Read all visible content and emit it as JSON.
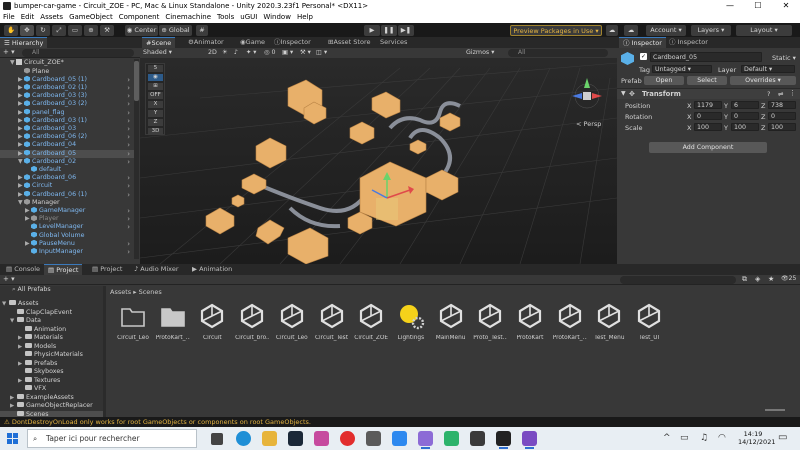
{
  "window": {
    "title": "bumper-car-game - Circuit_ZOE - PC, Mac & Linux Standalone - Unity 2020.3.23f1 Personal* <DX11>",
    "controls": [
      "—",
      "☐",
      "✕"
    ]
  },
  "menu": [
    "File",
    "Edit",
    "Assets",
    "GameObject",
    "Component",
    "Cinemachine",
    "Tools",
    "uGUI",
    "Window",
    "Help"
  ],
  "toolbar": {
    "pivot": "Center",
    "space": "Global",
    "packages": "Preview Packages in Use ▾",
    "account": "Account",
    "layers": "Layers",
    "layout": "Layout"
  },
  "hierarchy": {
    "tab": "Hierarchy",
    "search_placeholder": "All",
    "root": "Circuit_ZOE*",
    "items": [
      {
        "label": "Plane",
        "indent": 2,
        "prefab": false,
        "arrow": false,
        "selected": false,
        "dim": false,
        "expand": ""
      },
      {
        "label": "Cardboard_05 (1)",
        "indent": 2,
        "prefab": true,
        "arrow": true,
        "selected": false,
        "dim": false,
        "expand": "▶"
      },
      {
        "label": "Cardboard_02 (1)",
        "indent": 2,
        "prefab": true,
        "arrow": true,
        "selected": false,
        "dim": false,
        "expand": "▶"
      },
      {
        "label": "Cardboard_03 (3)",
        "indent": 2,
        "prefab": true,
        "arrow": true,
        "selected": false,
        "dim": false,
        "expand": "▶"
      },
      {
        "label": "Cardboard_03 (2)",
        "indent": 2,
        "prefab": true,
        "arrow": true,
        "selected": false,
        "dim": false,
        "expand": "▶"
      },
      {
        "label": "panel_flag",
        "indent": 2,
        "prefab": true,
        "arrow": true,
        "selected": false,
        "dim": false,
        "expand": "▶"
      },
      {
        "label": "Cardboard_03 (1)",
        "indent": 2,
        "prefab": true,
        "arrow": true,
        "selected": false,
        "dim": false,
        "expand": "▶"
      },
      {
        "label": "Cardboard_03",
        "indent": 2,
        "prefab": true,
        "arrow": true,
        "selected": false,
        "dim": false,
        "expand": "▶"
      },
      {
        "label": "Cardboard_06 (2)",
        "indent": 2,
        "prefab": true,
        "arrow": true,
        "selected": false,
        "dim": false,
        "expand": "▶"
      },
      {
        "label": "Cardboard_04",
        "indent": 2,
        "prefab": true,
        "arrow": true,
        "selected": false,
        "dim": false,
        "expand": "▶"
      },
      {
        "label": "Cardboard_05",
        "indent": 2,
        "prefab": true,
        "arrow": true,
        "selected": true,
        "dim": false,
        "expand": "▶"
      },
      {
        "label": "Cardboard_02",
        "indent": 2,
        "prefab": true,
        "arrow": true,
        "selected": false,
        "dim": false,
        "expand": "▼"
      },
      {
        "label": "default",
        "indent": 3,
        "prefab": true,
        "arrow": false,
        "selected": false,
        "dim": false,
        "expand": ""
      },
      {
        "label": "Cardboard_06",
        "indent": 2,
        "prefab": true,
        "arrow": true,
        "selected": false,
        "dim": false,
        "expand": "▶"
      },
      {
        "label": "Circuit",
        "indent": 2,
        "prefab": true,
        "arrow": true,
        "selected": false,
        "dim": false,
        "expand": "▶"
      },
      {
        "label": "Cardboard_06 (1)",
        "indent": 2,
        "prefab": true,
        "arrow": true,
        "selected": false,
        "dim": false,
        "expand": "▶"
      },
      {
        "label": "Manager",
        "indent": 2,
        "prefab": false,
        "arrow": false,
        "selected": false,
        "dim": false,
        "expand": "▼"
      },
      {
        "label": "GameManager",
        "indent": 3,
        "prefab": true,
        "arrow": true,
        "selected": false,
        "dim": false,
        "expand": "▶"
      },
      {
        "label": "Player",
        "indent": 3,
        "prefab": false,
        "arrow": true,
        "selected": false,
        "dim": true,
        "expand": "▶"
      },
      {
        "label": "LevelManager",
        "indent": 3,
        "prefab": true,
        "arrow": true,
        "selected": false,
        "dim": false,
        "expand": ""
      },
      {
        "label": "Global Volume",
        "indent": 3,
        "prefab": true,
        "arrow": false,
        "selected": false,
        "dim": false,
        "expand": ""
      },
      {
        "label": "PauseMenu",
        "indent": 3,
        "prefab": true,
        "arrow": true,
        "selected": false,
        "dim": false,
        "expand": "▶"
      },
      {
        "label": "InputManager",
        "indent": 3,
        "prefab": true,
        "arrow": true,
        "selected": false,
        "dim": false,
        "expand": ""
      }
    ]
  },
  "scene": {
    "tabs": [
      "Scene",
      "Animator",
      "Game",
      "Inspector",
      "Asset Store",
      "Services"
    ],
    "shading": "Shaded",
    "mode": "2D",
    "gizmos": "Gizmos",
    "search_placeholder": "All",
    "overlay_buttons": [
      "5",
      "OFF",
      "X",
      "Y",
      "Z",
      "3D"
    ],
    "persp": "< Persp"
  },
  "inspector": {
    "tabs": [
      "Inspector",
      "Inspector"
    ],
    "name": "Cardboard_05",
    "static_label": "Static ▾",
    "tag_label": "Tag",
    "tag": "Untagged",
    "layer_label": "Layer",
    "layer": "Default",
    "prefab_label": "Prefab",
    "prefab_buttons": [
      "Open",
      "Select",
      "Overrides"
    ],
    "component_title": "Transform",
    "rows": [
      {
        "label": "Position",
        "x": "1179",
        "y": "6",
        "z": "738"
      },
      {
        "label": "Rotation",
        "x": "0",
        "y": "0",
        "z": "0"
      },
      {
        "label": "Scale",
        "x": "100",
        "y": "100",
        "z": "100"
      }
    ],
    "add_component": "Add Component"
  },
  "project": {
    "tabs": [
      "Console",
      "Project",
      "Project",
      "Audio Mixer",
      "Animation"
    ],
    "favorites": "All Prefabs",
    "breadcrumb": [
      "Assets",
      "Scenes"
    ],
    "count": "25",
    "folders": [
      {
        "label": "Assets",
        "indent": 0,
        "expand": "▼",
        "selected": false
      },
      {
        "label": "ClapClapEvent",
        "indent": 1,
        "expand": "",
        "selected": false
      },
      {
        "label": "Data",
        "indent": 1,
        "expand": "▼",
        "selected": false
      },
      {
        "label": "Animation",
        "indent": 2,
        "expand": "",
        "selected": false
      },
      {
        "label": "Materials",
        "indent": 2,
        "expand": "▶",
        "selected": false
      },
      {
        "label": "Models",
        "indent": 2,
        "expand": "▶",
        "selected": false
      },
      {
        "label": "PhysicMaterials",
        "indent": 2,
        "expand": "",
        "selected": false
      },
      {
        "label": "Prefabs",
        "indent": 2,
        "expand": "▶",
        "selected": false
      },
      {
        "label": "Skyboxes",
        "indent": 2,
        "expand": "",
        "selected": false
      },
      {
        "label": "Textures",
        "indent": 2,
        "expand": "▶",
        "selected": false
      },
      {
        "label": "VFX",
        "indent": 2,
        "expand": "",
        "selected": false
      },
      {
        "label": "ExampleAssets",
        "indent": 1,
        "expand": "▶",
        "selected": false
      },
      {
        "label": "GameObjectReplacer",
        "indent": 1,
        "expand": "▶",
        "selected": false
      },
      {
        "label": "Scenes",
        "indent": 1,
        "expand": "",
        "selected": true
      }
    ],
    "assets": [
      {
        "label": "Circuit_Leo",
        "kind": "folder"
      },
      {
        "label": "ProtoKart_...",
        "kind": "folder-filled"
      },
      {
        "label": "Circuit",
        "kind": "unity"
      },
      {
        "label": "Circuit_bro...",
        "kind": "unity"
      },
      {
        "label": "Circuit_Leo",
        "kind": "unity"
      },
      {
        "label": "Circuit_Test",
        "kind": "unity"
      },
      {
        "label": "Circuit_ZOE",
        "kind": "unity"
      },
      {
        "label": "Lightings",
        "kind": "lighting"
      },
      {
        "label": "MainMenu",
        "kind": "unity"
      },
      {
        "label": "Proto_Test...",
        "kind": "unity"
      },
      {
        "label": "ProtoKart",
        "kind": "unity"
      },
      {
        "label": "ProtoKart_...",
        "kind": "unity"
      },
      {
        "label": "Test_Menu",
        "kind": "unity"
      },
      {
        "label": "Test_UI",
        "kind": "unity"
      }
    ]
  },
  "status": {
    "message": "DontDestroyOnLoad only works for root GameObjects or components on root GameObjects."
  },
  "taskbar": {
    "search_placeholder": "Taper ici pour rechercher",
    "time": "14:19",
    "date": "14/12/2021"
  },
  "colors": {
    "accent": "#3a79bb",
    "prefab_text": "#7fb8f0",
    "warning": "#e3b341",
    "selection": "#4d4d4d",
    "cardboard": "#e8b06a"
  }
}
